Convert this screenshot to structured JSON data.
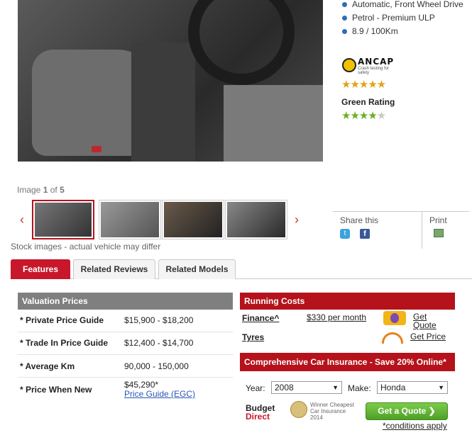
{
  "specs": [
    "Automatic, Front Wheel Drive",
    "Petrol - Premium ULP",
    "8.9 / 100Km"
  ],
  "ancap": {
    "name": "ANCAP",
    "tagline": "Crash testing for safety",
    "stars_filled": 5,
    "stars_total": 5
  },
  "green_rating": {
    "label": "Green Rating",
    "stars_filled": 4,
    "stars_total": 5
  },
  "gallery": {
    "prefix": "Image",
    "current": "1",
    "of_word": "of",
    "total": "5",
    "stock_note": "Stock images - actual vehicle may differ",
    "prev_arrow": "‹",
    "next_arrow": "›"
  },
  "share": {
    "label": "Share this",
    "print_label": "Print",
    "twitter_glyph": "t",
    "facebook_glyph": "f"
  },
  "tabs": [
    {
      "label": "Features",
      "active": true
    },
    {
      "label": "Related Reviews",
      "active": false
    },
    {
      "label": "Related Models",
      "active": false
    }
  ],
  "valuation": {
    "title": "Valuation Prices",
    "rows": [
      {
        "label": "* Private Price Guide",
        "value": "$15,900 - $18,200"
      },
      {
        "label": "* Trade In Price Guide",
        "value": "$12,400 - $14,700"
      },
      {
        "label": "* Average Km",
        "value": "90,000 - 150,000"
      },
      {
        "label": "* Price When New",
        "value": "$45,290*",
        "link": "Price Guide (EGC)"
      }
    ]
  },
  "running_costs": {
    "title": "Running Costs",
    "finance": {
      "label": "Finance^",
      "value": "$330 per month",
      "link": "Get Quote"
    },
    "tyres": {
      "label": "Tyres",
      "link": "Get Price"
    }
  },
  "insurance": {
    "title": "Comprehensive Car Insurance - Save 20% Online*",
    "year_label": "Year:",
    "year_value": "2008",
    "make_label": "Make:",
    "make_value": "Honda",
    "brand_line1": "Budget",
    "brand_line2": "Direct",
    "award": "Winner Cheapest Car Insurance 2014",
    "cta": "Get a Quote ❯",
    "conditions": "*conditions apply"
  },
  "colors": {
    "accent_red": "#b5121b",
    "tab_red": "#c8172a",
    "grey_header": "#7f7f7f",
    "link_blue": "#2a57b8",
    "cta_green": "#5fb52f"
  }
}
